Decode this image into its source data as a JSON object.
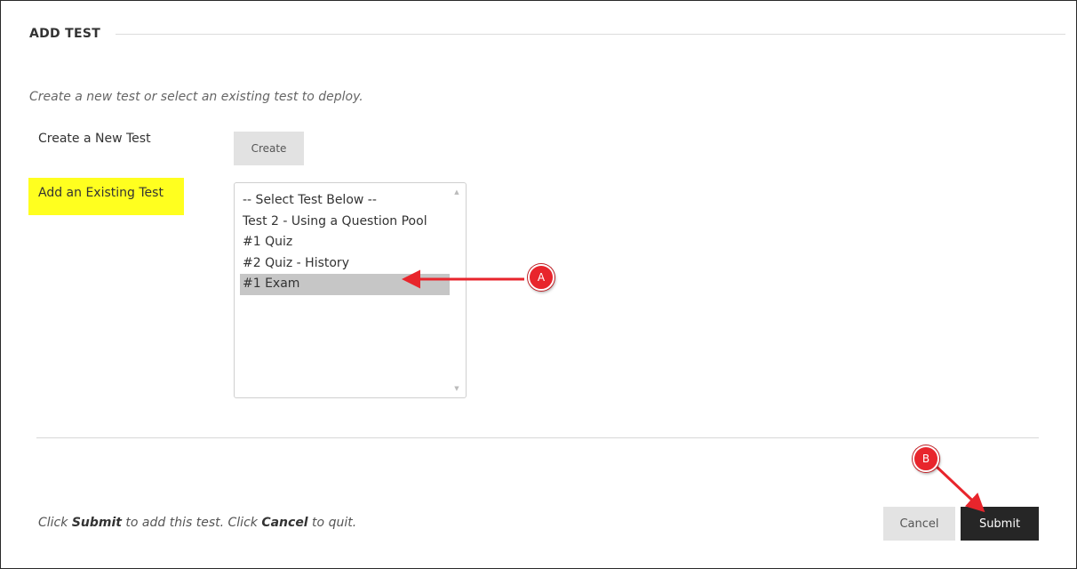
{
  "section": {
    "title": "ADD TEST"
  },
  "intro_text": "Create a new test or select an existing test to deploy.",
  "create_new": {
    "label": "Create a New Test",
    "button_label": "Create"
  },
  "add_existing": {
    "label": "Add an Existing Test",
    "highlight_color": "#ffff1f",
    "options": [
      "-- Select Test Below --",
      "Test 2 - Using a Question Pool",
      "#1 Quiz",
      "#2 Quiz - History",
      "#1 Exam"
    ],
    "selected_option": "#1 Exam"
  },
  "footer": {
    "text_before_submit": "Click ",
    "submit_word": "Submit",
    "text_middle": " to add this test. Click ",
    "cancel_word": "Cancel",
    "text_after_cancel": " to quit.",
    "cancel_label": "Cancel",
    "submit_label": "Submit"
  },
  "annotations": {
    "marker_a": "A",
    "marker_b": "B",
    "marker_color": "#e8252c"
  }
}
